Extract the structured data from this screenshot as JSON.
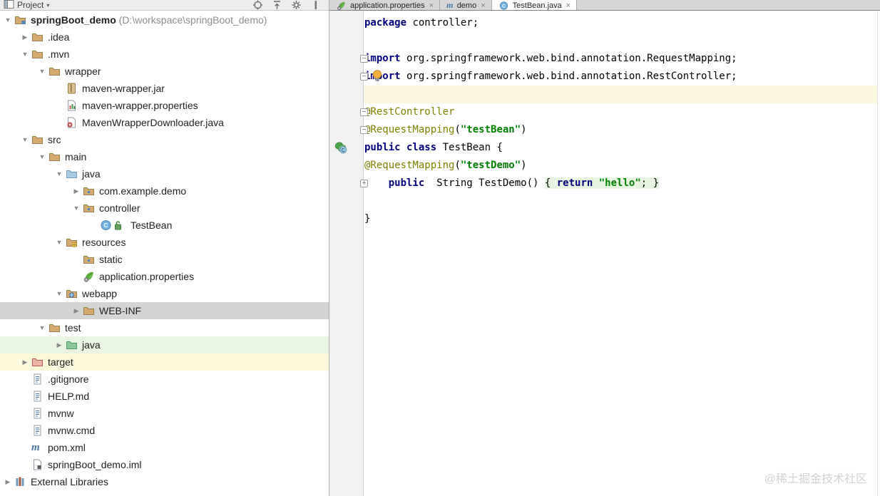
{
  "project_panel": {
    "header": {
      "title": "Project",
      "caret": "▾",
      "icons": [
        {
          "name": "locate-icon"
        },
        {
          "name": "collapse-all-icon"
        },
        {
          "name": "settings-gear-icon"
        },
        {
          "name": "hide-panel-icon"
        }
      ]
    },
    "tree": [
      {
        "label": "springBoot_demo",
        "path_suffix": " (D:\\workspace\\springBoot_demo)",
        "icon": "folder-project",
        "level": 0,
        "arrow": "expanded",
        "bold": true
      },
      {
        "label": ".idea",
        "icon": "folder",
        "level": 1,
        "arrow": "collapsed"
      },
      {
        "label": ".mvn",
        "icon": "folder",
        "level": 1,
        "arrow": "expanded"
      },
      {
        "label": "wrapper",
        "icon": "folder",
        "level": 2,
        "arrow": "expanded"
      },
      {
        "label": "maven-wrapper.jar",
        "icon": "jar-file",
        "level": 3,
        "arrow": "none"
      },
      {
        "label": "maven-wrapper.properties",
        "icon": "properties-file",
        "level": 3,
        "arrow": "none"
      },
      {
        "label": "MavenWrapperDownloader.java",
        "icon": "java-file",
        "level": 3,
        "arrow": "none"
      },
      {
        "label": "src",
        "icon": "folder",
        "level": 1,
        "arrow": "expanded"
      },
      {
        "label": "main",
        "icon": "folder",
        "level": 2,
        "arrow": "expanded"
      },
      {
        "label": "java",
        "icon": "folder-source",
        "level": 3,
        "arrow": "expanded"
      },
      {
        "label": "com.example.demo",
        "icon": "folder-package",
        "level": 4,
        "arrow": "collapsed"
      },
      {
        "label": "controller",
        "icon": "folder-package",
        "level": 4,
        "arrow": "expanded"
      },
      {
        "label": "TestBean",
        "icon": "class-lock",
        "level": 5,
        "arrow": "none"
      },
      {
        "label": "resources",
        "icon": "folder-resources",
        "level": 3,
        "arrow": "expanded"
      },
      {
        "label": "static",
        "icon": "folder-package",
        "level": 4,
        "arrow": "none"
      },
      {
        "label": "application.properties",
        "icon": "spring-leaf",
        "level": 4,
        "arrow": "none"
      },
      {
        "label": "webapp",
        "icon": "folder-web",
        "level": 3,
        "arrow": "expanded"
      },
      {
        "label": "WEB-INF",
        "icon": "folder",
        "level": 4,
        "arrow": "collapsed",
        "row_bg": "selected"
      },
      {
        "label": "test",
        "icon": "folder",
        "level": 2,
        "arrow": "expanded"
      },
      {
        "label": "java",
        "icon": "folder-test",
        "level": 3,
        "arrow": "collapsed",
        "row_bg": "green"
      },
      {
        "label": "target",
        "icon": "folder-excluded",
        "level": 1,
        "arrow": "collapsed",
        "row_bg": "yellow"
      },
      {
        "label": ".gitignore",
        "icon": "text-file",
        "level": 1,
        "arrow": "none"
      },
      {
        "label": "HELP.md",
        "icon": "text-file",
        "level": 1,
        "arrow": "none"
      },
      {
        "label": "mvnw",
        "icon": "text-file",
        "level": 1,
        "arrow": "none"
      },
      {
        "label": "mvnw.cmd",
        "icon": "text-file",
        "level": 1,
        "arrow": "none"
      },
      {
        "label": "pom.xml",
        "icon": "maven-file",
        "level": 1,
        "arrow": "none"
      },
      {
        "label": "springBoot_demo.iml",
        "icon": "iml-file",
        "level": 1,
        "arrow": "none"
      },
      {
        "label": "External Libraries",
        "icon": "libraries",
        "level": 0,
        "arrow": "collapsed"
      }
    ]
  },
  "tabs": [
    {
      "label": "application.properties",
      "icon": "spring-leaf",
      "close": "×",
      "active": false
    },
    {
      "label": "demo",
      "icon": "maven-file",
      "close": "×",
      "active": false
    },
    {
      "label": "TestBean.java",
      "icon": "class",
      "close": "×",
      "active": true
    }
  ],
  "editor": {
    "lines": [
      {
        "segments": [
          {
            "t": "package",
            "c": "kw"
          },
          {
            "t": " controller;",
            "c": "pl"
          }
        ]
      },
      {
        "segments": []
      },
      {
        "gutter": "minus",
        "segments": [
          {
            "t": "import",
            "c": "kw"
          },
          {
            "t": " org.springframework.web.bind.annotation.RequestMapping;",
            "c": "pl"
          }
        ]
      },
      {
        "gutter": "minus",
        "bulb": true,
        "segments": [
          {
            "t": "import",
            "c": "kw"
          },
          {
            "t": " org.springframework.web.bind.annotation.RestController;",
            "c": "pl"
          }
        ]
      },
      {
        "highlight": true,
        "segments": []
      },
      {
        "gutter": "minus",
        "segments": [
          {
            "t": "@RestController",
            "c": "ann"
          }
        ]
      },
      {
        "gutter": "minus",
        "segments": [
          {
            "t": "@RequestMapping",
            "c": "ann"
          },
          {
            "t": "(",
            "c": "pl"
          },
          {
            "t": "\"testBean\"",
            "c": "str"
          },
          {
            "t": ")",
            "c": "pl"
          }
        ]
      },
      {
        "gutter": "bean",
        "segments": [
          {
            "t": "public class",
            "c": "kw"
          },
          {
            "t": " TestBean {",
            "c": "pl"
          }
        ]
      },
      {
        "segments": [
          {
            "t": "@RequestMapping",
            "c": "ann"
          },
          {
            "t": "(",
            "c": "pl"
          },
          {
            "t": "\"testDemo\"",
            "c": "str"
          },
          {
            "t": ")",
            "c": "pl"
          }
        ]
      },
      {
        "gutter": "plus",
        "segments": [
          {
            "t": "    ",
            "c": "pl"
          },
          {
            "t": "public",
            "c": "kw"
          },
          {
            "t": "  String TestDemo() ",
            "c": "pl"
          },
          {
            "t": "{ ",
            "c": "pl g"
          },
          {
            "t": "return",
            "c": "kw g"
          },
          {
            "t": " ",
            "c": "pl g"
          },
          {
            "t": "\"hello\"",
            "c": "str g"
          },
          {
            "t": "; ",
            "c": "pl g"
          },
          {
            "t": "}",
            "c": "pl g"
          }
        ]
      },
      {
        "segments": []
      },
      {
        "segments": [
          {
            "t": "}",
            "c": "pl"
          }
        ]
      }
    ]
  },
  "watermark": "@稀土掘金技术社区",
  "colors": {
    "keyword": "#000080",
    "annotation": "#808000",
    "string": "#008000",
    "current_line_bg": "#FBF7DC",
    "selected_row_bg": "#D4D4D4",
    "test_row_bg": "#E9F5E1",
    "excluded_row_bg": "#FBF8DC",
    "folder_tan": "#D5AA6E",
    "gutter_bg": "#F1F1F1"
  }
}
